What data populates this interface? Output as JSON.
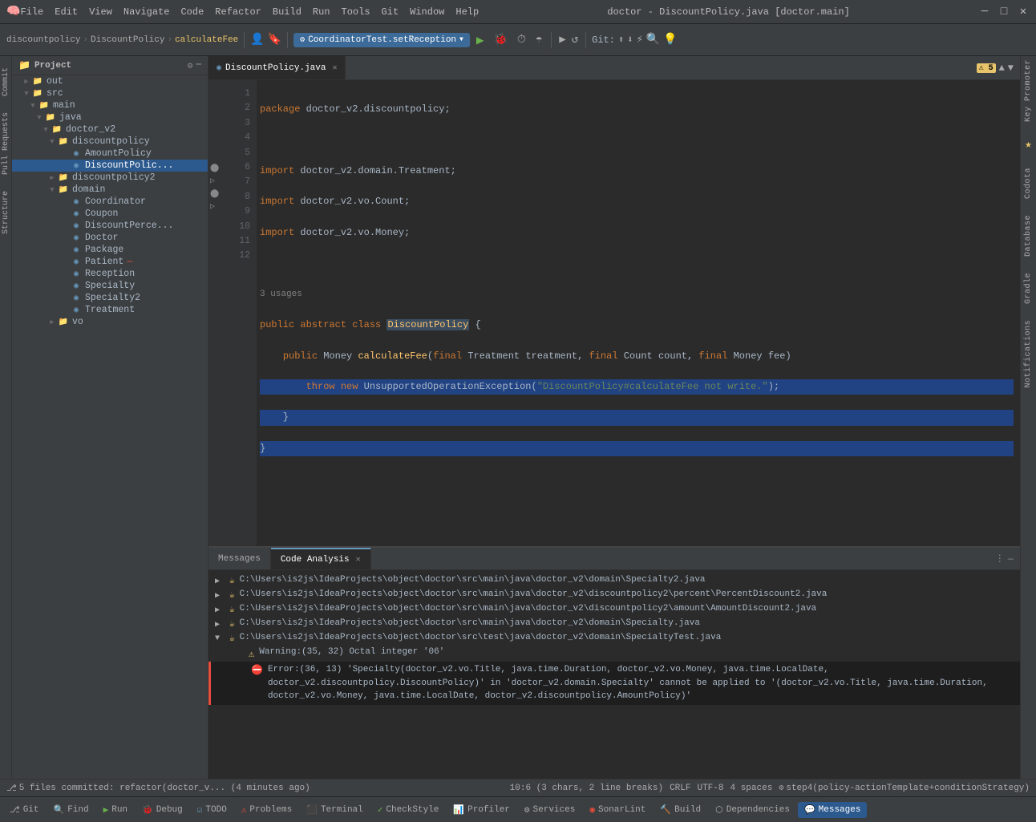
{
  "titlebar": {
    "title": "doctor - DiscountPolicy.java [doctor.main]",
    "menu": [
      "File",
      "Edit",
      "View",
      "Navigate",
      "Code",
      "Refactor",
      "Build",
      "Run",
      "Tools",
      "Git",
      "Window",
      "Help"
    ]
  },
  "toolbar": {
    "breadcrumb": {
      "project": "discountpolicy",
      "class": "DiscountPolicy",
      "method": "calculateFee"
    },
    "run_config": "CoordinatorTest.setReception",
    "git_label": "Git:"
  },
  "tabs": {
    "open": [
      {
        "label": "DiscountPolicy.java",
        "active": true
      }
    ]
  },
  "code": {
    "filename": "DiscountPolicy.java",
    "lines": [
      {
        "num": 1,
        "text": "package doctor_v2.discountpolicy;"
      },
      {
        "num": 2,
        "text": ""
      },
      {
        "num": 3,
        "text": "import doctor_v2.domain.Treatment;"
      },
      {
        "num": 4,
        "text": "import doctor_v2.vo.Count;"
      },
      {
        "num": 5,
        "text": "import doctor_v2.vo.Money;"
      },
      {
        "num": 6,
        "text": ""
      },
      {
        "num": 7,
        "text": "3 usages"
      },
      {
        "num": 8,
        "text": "public abstract class DiscountPolicy {"
      },
      {
        "num": 9,
        "text": "    public Money calculateFee(final Treatment treatment, final Count count, final Money fee)"
      },
      {
        "num": 10,
        "text": "        throw new UnsupportedOperationException(\"DiscountPolicy#calculateFee not write.\");"
      },
      {
        "num": 11,
        "text": "    }"
      },
      {
        "num": 12,
        "text": "}"
      }
    ]
  },
  "sidebar": {
    "title": "Project",
    "tree": {
      "items": [
        {
          "label": "out",
          "type": "folder",
          "indent": 2,
          "expanded": false
        },
        {
          "label": "src",
          "type": "folder",
          "indent": 2,
          "expanded": true
        },
        {
          "label": "main",
          "type": "folder",
          "indent": 4,
          "expanded": true
        },
        {
          "label": "java",
          "type": "folder",
          "indent": 6,
          "expanded": true
        },
        {
          "label": "doctor_v2",
          "type": "folder",
          "indent": 8,
          "expanded": true
        },
        {
          "label": "discountpolicy",
          "type": "folder",
          "indent": 10,
          "expanded": true
        },
        {
          "label": "AmountPolicy",
          "type": "java-interface",
          "indent": 14
        },
        {
          "label": "DiscountPolicy",
          "type": "java-interface",
          "indent": 14
        },
        {
          "label": "discountpolicy2",
          "type": "folder",
          "indent": 10
        },
        {
          "label": "domain",
          "type": "folder",
          "indent": 10,
          "expanded": true
        },
        {
          "label": "Coordinator",
          "type": "java-class",
          "indent": 14
        },
        {
          "label": "Coupon",
          "type": "java-class",
          "indent": 14
        },
        {
          "label": "DiscountPerce...",
          "type": "java-class",
          "indent": 14
        },
        {
          "label": "Doctor",
          "type": "java-class",
          "indent": 14
        },
        {
          "label": "Package",
          "type": "java-class",
          "indent": 14
        },
        {
          "label": "Patient",
          "type": "java-class",
          "indent": 14
        },
        {
          "label": "Reception",
          "type": "java-class",
          "indent": 14
        },
        {
          "label": "Specialty",
          "type": "java-class",
          "indent": 14
        },
        {
          "label": "Specialty2",
          "type": "java-class",
          "indent": 14
        },
        {
          "label": "Treatment",
          "type": "java-class",
          "indent": 14
        },
        {
          "label": "vo",
          "type": "folder",
          "indent": 10
        }
      ]
    }
  },
  "bottom_panel": {
    "tabs": [
      {
        "label": "Messages",
        "active": false
      },
      {
        "label": "Code Analysis",
        "active": true,
        "closeable": true
      }
    ],
    "errors": [
      {
        "type": "file",
        "path": "C:\\Users\\is2js\\IdeaProjects\\object\\doctor\\src\\main\\java\\doctor_v2\\domain\\Specialty2.java",
        "indent": 0
      },
      {
        "type": "file",
        "path": "C:\\Users\\is2js\\IdeaProjects\\object\\doctor\\src\\main\\java\\doctor_v2\\discountpolicy2\\percent\\PercentDiscount2.java",
        "indent": 0
      },
      {
        "type": "file",
        "path": "C:\\Users\\is2js\\IdeaProjects\\object\\doctor\\src\\main\\java\\doctor_v2\\discountpolicy2\\amount\\AmountDiscount2.java",
        "indent": 0
      },
      {
        "type": "file",
        "path": "C:\\Users\\is2js\\IdeaProjects\\object\\doctor\\src\\main\\java\\doctor_v2\\domain\\Specialty.java",
        "indent": 0
      },
      {
        "type": "file",
        "path": "C:\\Users\\is2js\\IdeaProjects\\object\\doctor\\src\\test\\java\\doctor_v2\\domain\\SpecialtyTest.java",
        "indent": 0,
        "expanded": true
      },
      {
        "type": "warning",
        "text": "Warning:(35, 32)  Octal integer '06'",
        "indent": 1
      },
      {
        "type": "error",
        "text": "Error:(36, 13)  'Specialty(doctor_v2.vo.Title, java.time.Duration, doctor_v2.vo.Money, java.time.LocalDate, doctor_v2.discountpolicy.DiscountPolicy)' in 'doctor_v2.domain.Specialty' cannot be applied to '(doctor_v2.vo.Title, java.time.Duration, doctor_v2.vo.Money, java.time.LocalDate, doctor_v2.discountpolicy.AmountPolicy)'",
        "indent": 1,
        "selected": true
      }
    ]
  },
  "statusbar": {
    "git": "5 files committed: refactor(doctor_v... (4 minutes ago)",
    "position": "10:6 (3 chars, 2 line breaks)",
    "encoding": "CRLF",
    "charset": "UTF-8",
    "indent": "4 spaces",
    "branch": "step4(policy-actionTemplate+conditionStrategy)"
  },
  "taskbar": {
    "items": [
      {
        "label": "Git",
        "icon": "⎇",
        "active": false
      },
      {
        "label": "Find",
        "icon": "🔍",
        "active": false
      },
      {
        "label": "Run",
        "icon": "▶",
        "active": false
      },
      {
        "label": "Debug",
        "icon": "🐞",
        "active": false
      },
      {
        "label": "TODO",
        "icon": "☑",
        "active": false
      },
      {
        "label": "Problems",
        "icon": "⚠",
        "active": false
      },
      {
        "label": "Terminal",
        "icon": "⬛",
        "active": false
      },
      {
        "label": "CheckStyle",
        "icon": "✓",
        "active": false
      },
      {
        "label": "Profiler",
        "icon": "📊",
        "active": false
      },
      {
        "label": "Services",
        "icon": "⚙",
        "active": false
      },
      {
        "label": "SonarLint",
        "icon": "◉",
        "active": false
      },
      {
        "label": "Build",
        "icon": "🔨",
        "active": false
      },
      {
        "label": "Dependencies",
        "icon": "⬡",
        "active": false
      },
      {
        "label": "Messages",
        "icon": "💬",
        "active": true
      }
    ]
  },
  "right_side": {
    "labels": [
      "Key Promoter",
      "Codota",
      "Database",
      "Gradle",
      "Notifications"
    ]
  }
}
